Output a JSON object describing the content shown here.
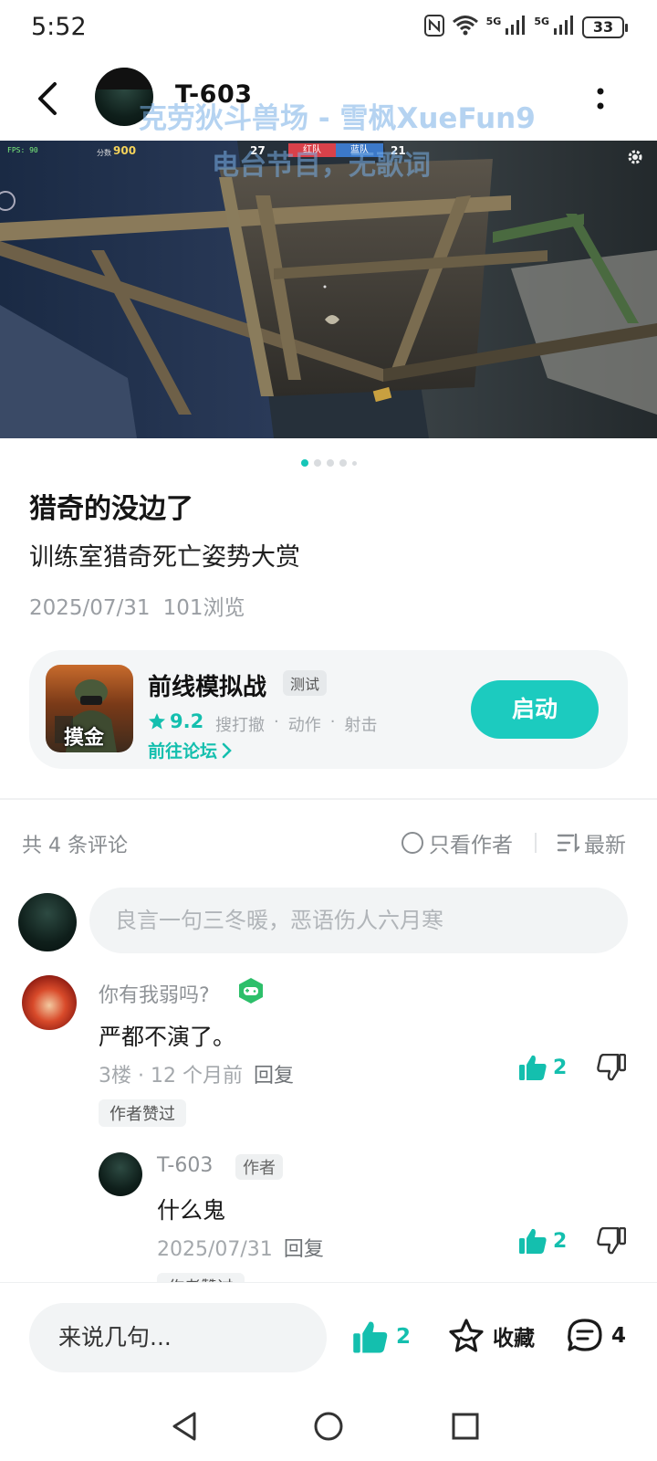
{
  "status_bar": {
    "time": "5:52",
    "network1": "5G",
    "network2": "5G",
    "battery": "33",
    "icons": [
      "nfc-icon",
      "wifi-icon",
      "signal-icon",
      "signal-icon",
      "battery-icon"
    ]
  },
  "header": {
    "username": "T-603",
    "back_icon": "chevron-left-icon",
    "more_icon": "more-vertical-icon"
  },
  "watermark": {
    "line1": "克劳狄斗兽场 - 雪枫XueFun9",
    "line2": "电台节目，无歌词"
  },
  "game_hud": {
    "fps": "FPS: 90",
    "score_label": "分数",
    "score": "900",
    "left_score": "27",
    "red_team": "红队",
    "blue_team": "蓝队",
    "right_score": "21"
  },
  "carousel": {
    "total": 5,
    "active": 1
  },
  "post": {
    "title": "猎奇的没边了",
    "subtitle": "训练室猎奇死亡姿势大赏",
    "date": "2025/07/31",
    "views": "101浏览"
  },
  "game_card": {
    "name": "前线模拟战",
    "tag": "测试",
    "rating": "9.2",
    "genres": [
      "搜打撤",
      "·",
      "动作",
      "·",
      "射击"
    ],
    "forum_link": "前往论坛",
    "launch_label": "启动",
    "icon_text": "摸金"
  },
  "comments_header": {
    "count_label": "共 4 条评论",
    "only_author_label": "只看作者",
    "sort_label": "最新"
  },
  "comment_input": {
    "placeholder": "良言一句三冬暖，恶语伤人六月寒"
  },
  "comments": [
    {
      "author": "你有我弱吗?",
      "text": "严都不演了。",
      "floor": "3楼",
      "time": "12 个月前",
      "reply_label": "回复",
      "likes": "2",
      "badge": "作者赞过"
    },
    {
      "author": "T-603",
      "author_tag": "作者",
      "text": "什么鬼",
      "time": "2025/07/31",
      "reply_label": "回复",
      "likes": "2",
      "badge": "作者赞过"
    }
  ],
  "bottom_bar": {
    "say_placeholder": "来说几句...",
    "like_count": "2",
    "favorite_label": "收藏",
    "comment_count": "4"
  },
  "colors": {
    "accent": "#1ccbbf",
    "accent_text": "#14bfae",
    "muted": "#8f9397"
  }
}
